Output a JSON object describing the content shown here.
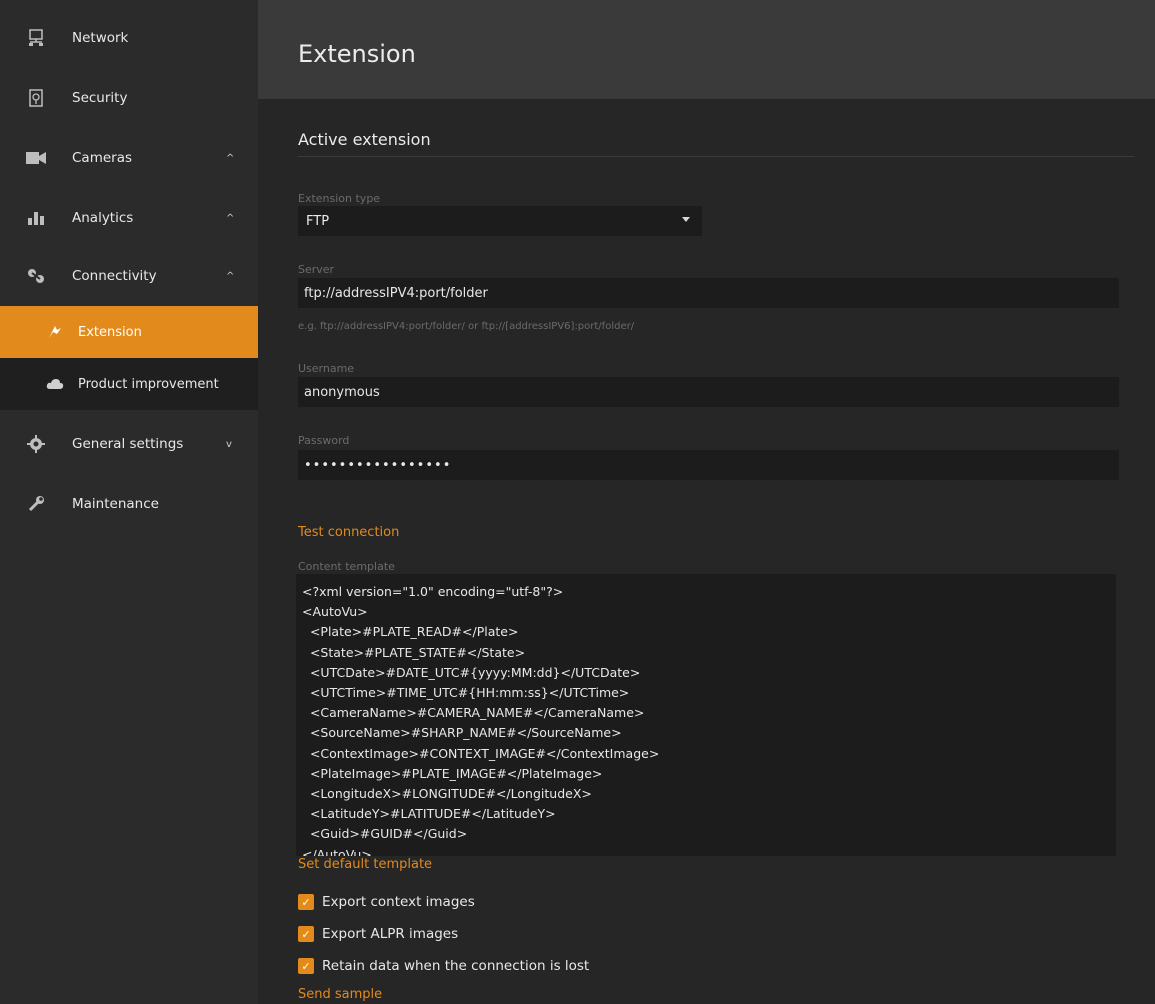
{
  "sidebar": {
    "items": [
      {
        "label": "Network",
        "icon": "network-icon"
      },
      {
        "label": "Security",
        "icon": "security-icon"
      },
      {
        "label": "Cameras",
        "icon": "camera-icon",
        "chevron": "^"
      },
      {
        "label": "Analytics",
        "icon": "analytics-icon",
        "chevron": "^"
      },
      {
        "label": "Connectivity",
        "icon": "connectivity-icon",
        "chevron": "^"
      },
      {
        "label": "General settings",
        "icon": "gear-icon",
        "chevron": "v"
      },
      {
        "label": "Maintenance",
        "icon": "wrench-icon"
      }
    ],
    "sub_items": [
      {
        "label": "Extension",
        "icon": "extension-icon",
        "active": true
      },
      {
        "label": "Product improvement",
        "icon": "cloud-icon",
        "active": false
      }
    ]
  },
  "header": {
    "title": "Extension"
  },
  "main": {
    "section_title": "Active extension",
    "extension_type": {
      "label": "Extension type",
      "value": "FTP"
    },
    "server": {
      "label": "Server",
      "value": "ftp://addressIPV4:port/folder",
      "hint": "e.g. ftp://addressIPV4:port/folder/ or ftp://[addressIPV6]:port/folder/"
    },
    "username": {
      "label": "Username",
      "value": "anonymous"
    },
    "password": {
      "label": "Password",
      "value": "•••••••••••••••••"
    },
    "test_connection": "Test connection",
    "content_template": {
      "label": "Content template",
      "lines": [
        "<?xml version=\"1.0\" encoding=\"utf-8\"?>",
        "<AutoVu>",
        "  <Plate>#PLATE_READ#</Plate>",
        "  <State>#PLATE_STATE#</State>",
        "  <UTCDate>#DATE_UTC#{yyyy:MM:dd}</UTCDate>",
        "  <UTCTime>#TIME_UTC#{HH:mm:ss}</UTCTime>",
        "  <CameraName>#CAMERA_NAME#</CameraName>",
        "  <SourceName>#SHARP_NAME#</SourceName>",
        "  <ContextImage>#CONTEXT_IMAGE#</ContextImage>",
        "  <PlateImage>#PLATE_IMAGE#</PlateImage>",
        "  <LongitudeX>#LONGITUDE#</LongitudeX>",
        "  <LatitudeY>#LATITUDE#</LatitudeY>",
        "  <Guid>#GUID#</Guid>",
        "</AutoVu>"
      ]
    },
    "set_default_template": "Set default template",
    "checkboxes": [
      {
        "label": "Export context images",
        "checked": true
      },
      {
        "label": "Export ALPR images",
        "checked": true
      },
      {
        "label": "Retain data when the connection is lost",
        "checked": true
      }
    ],
    "send_sample": "Send sample"
  },
  "colors": {
    "accent": "#e38a1c",
    "sidebar_bg": "#2b2b2b",
    "content_bg": "#262626",
    "input_bg": "#1c1c1c"
  }
}
